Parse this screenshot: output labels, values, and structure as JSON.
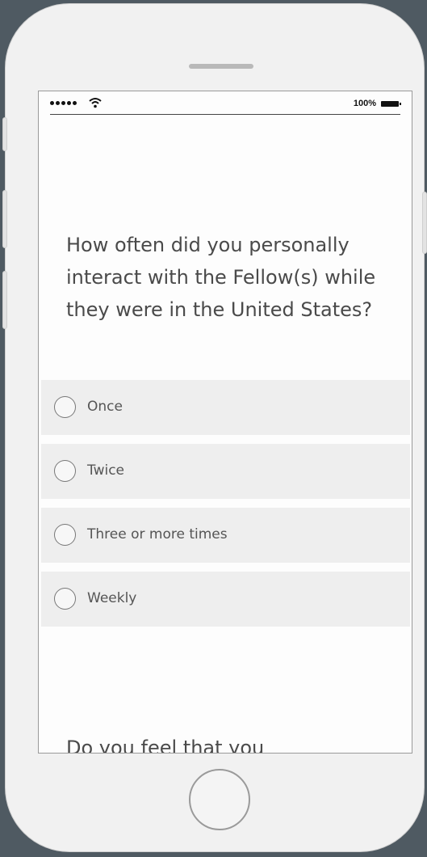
{
  "status_bar": {
    "battery_text": "100%",
    "signal_icon": "signal-dots-icon",
    "wifi_icon": "wifi-icon",
    "battery_icon": "battery-icon"
  },
  "survey": {
    "question": "How often did you personally interact with the Fellow(s) while they were in the United States?",
    "options": [
      {
        "label": "Once"
      },
      {
        "label": "Twice"
      },
      {
        "label": "Three or more times"
      },
      {
        "label": "Weekly"
      }
    ],
    "next_question_partial": "Do you feel that you"
  },
  "colors": {
    "background": "#4f5a62",
    "phone_body": "#f1f1f1",
    "option_background": "#eeeeee",
    "text": "#4a4a4a"
  }
}
